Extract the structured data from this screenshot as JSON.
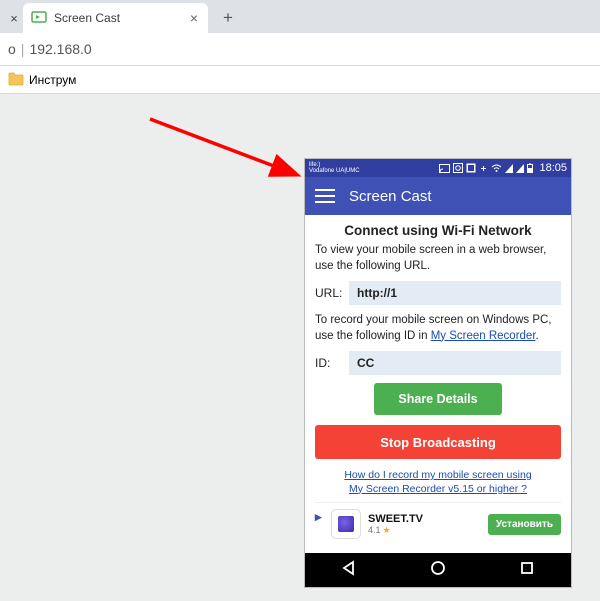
{
  "browser": {
    "tab_title": "Screen Cast",
    "address": "192.168.0",
    "bookmark": "Инструм",
    "nav_prefix": "о"
  },
  "phone": {
    "status": {
      "carrier_top": "life:)",
      "carrier_bottom": "Vodafone UA|UMC",
      "time": "18:05"
    },
    "appbar": {
      "title": "Screen Cast"
    },
    "wifi_section": {
      "heading": "Connect using Wi-Fi Network",
      "description": "To view your mobile screen in a web browser, use the following URL.",
      "url_label": "URL:",
      "url_value": "http://1"
    },
    "record_section": {
      "description_a": "To record your mobile screen on Windows PC, use the following ID in ",
      "link_text": "My Screen Recorder",
      "description_b": ".",
      "id_label": "ID:",
      "id_value": "CC"
    },
    "buttons": {
      "share": "Share Details",
      "stop": "Stop Broadcasting"
    },
    "help": {
      "line1": "How do I record my mobile screen using",
      "line2": "My Screen Recorder v5.15 or higher ?"
    },
    "ad": {
      "title": "SWEET.TV",
      "rating": "4.1",
      "cta": "Установить"
    }
  }
}
